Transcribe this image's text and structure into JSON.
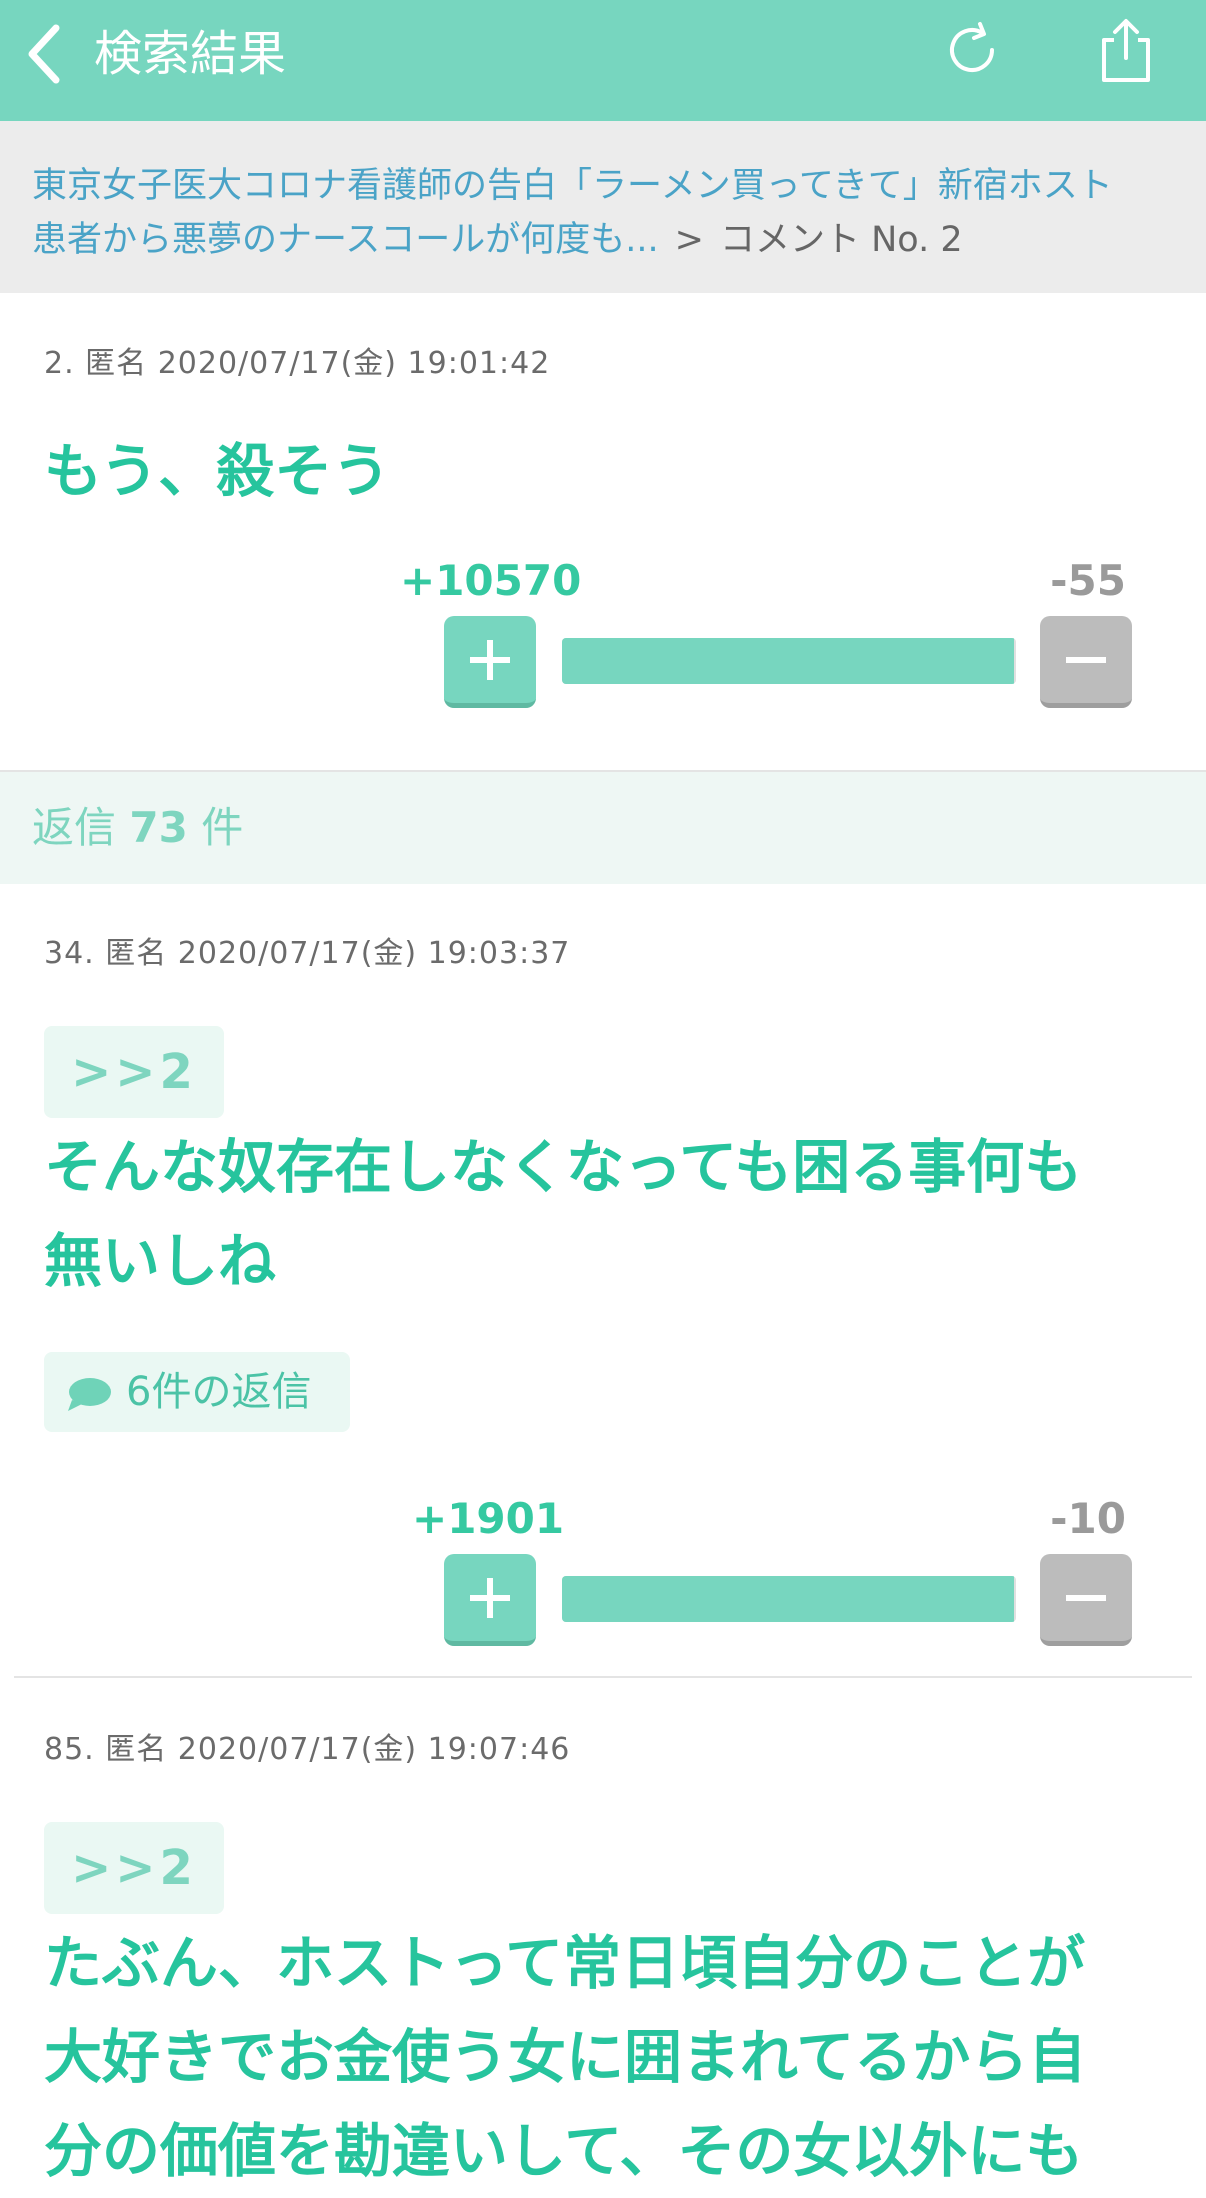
{
  "header": {
    "title": "検索結果"
  },
  "breadcrumb": {
    "link_line1": "東京女子医大コロナ看護師の告白「ラーメン買ってきて」新宿ホスト",
    "link_line2": "患者から悪夢のナースコールが何度も...",
    "separator": ">",
    "current": "コメント No. 2"
  },
  "main_comment": {
    "meta": "2. 匿名 2020/07/17(金) 19:01:42",
    "text": "もう、殺そう",
    "plus": "+10570",
    "minus": "-55",
    "plus_fraction": 0.9948
  },
  "replies_header": {
    "prefix": "返信",
    "count": "73",
    "suffix": "件"
  },
  "replies": [
    {
      "meta": "34. 匿名 2020/07/17(金) 19:03:37",
      "quote": ">>2",
      "text_line1": "そんな奴存在しなくなっても困る事何も",
      "text_line2": "無いしね",
      "reply_link": "6件の返信",
      "plus": "+1901",
      "minus": "-10",
      "plus_fraction": 0.9948
    },
    {
      "meta": "85. 匿名 2020/07/17(金) 19:07:46",
      "quote": ">>2",
      "text_line1": "たぶん、ホストって常日頃自分のことが",
      "text_line2": "大好きでお金使う女に囲まれてるから自",
      "text_line3": "分の価値を勘違いして、その女以外にも"
    }
  ],
  "colors": {
    "accent": "#77d6bf",
    "text_green": "#26c49d",
    "link_blue": "#4aa3c7"
  }
}
